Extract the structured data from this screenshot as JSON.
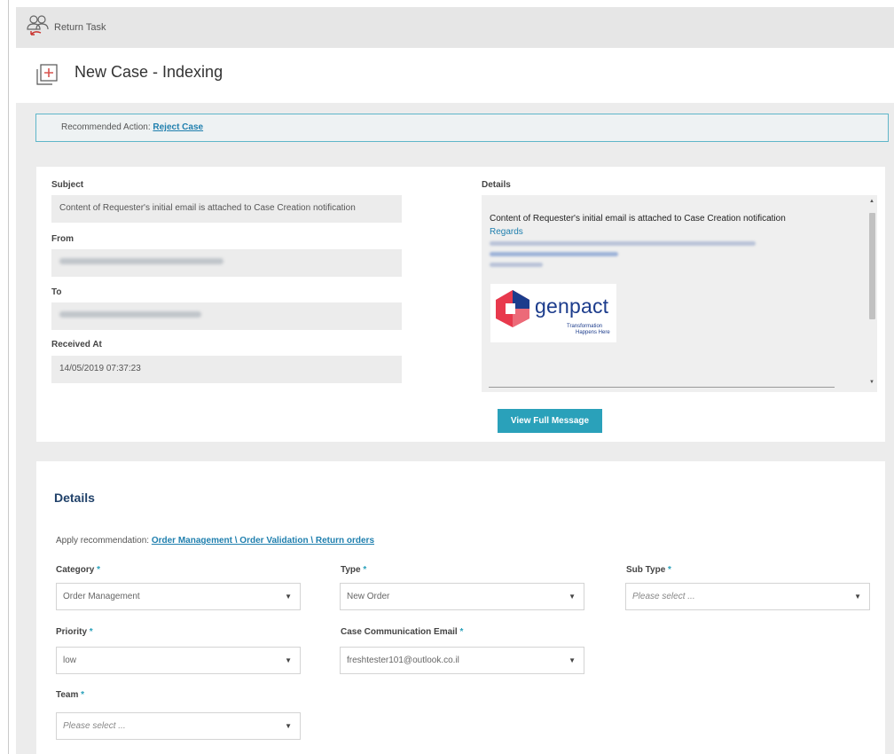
{
  "toolbar": {
    "return_task_label": "Return Task"
  },
  "page": {
    "title": "New Case - Indexing"
  },
  "recommendation": {
    "prefix": "Recommended Action: ",
    "action": "Reject Case"
  },
  "email": {
    "subject_label": "Subject",
    "subject_value": "Content of Requester's initial email is attached to Case Creation notification",
    "from_label": "From",
    "to_label": "To",
    "received_label": "Received At",
    "received_value": "14/05/2019 07:37:23",
    "details_label": "Details",
    "details_text": "Content of Requester's initial email is attached to Case Creation notification",
    "regards": "Regards",
    "logo_word": "genpact",
    "logo_tagline_1": "Transformation",
    "logo_tagline_2": "Happens Here",
    "view_button": "View Full Message",
    "scroll_up_icon": "▲",
    "scroll_down_icon": "▼"
  },
  "details": {
    "title": "Details",
    "apply_prefix": "Apply recommendation: ",
    "apply_link": "Order Management \\ Order Validation \\ Return orders",
    "required_mark": "*",
    "caret_icon": "▼",
    "category": {
      "label": "Category",
      "value": "Order Management"
    },
    "type": {
      "label": "Type",
      "value": "New Order"
    },
    "sub_type": {
      "label": "Sub Type",
      "placeholder": "Please select ..."
    },
    "priority": {
      "label": "Priority",
      "value": "low"
    },
    "case_email": {
      "label": "Case Communication Email",
      "value": "freshtester101@outlook.co.il"
    },
    "team": {
      "label": "Team",
      "placeholder": "Please select ..."
    }
  },
  "colors": {
    "accent": "#2aa1ba",
    "link": "#1f7fae",
    "heading": "#21426a",
    "panel_bg": "#ececec"
  }
}
